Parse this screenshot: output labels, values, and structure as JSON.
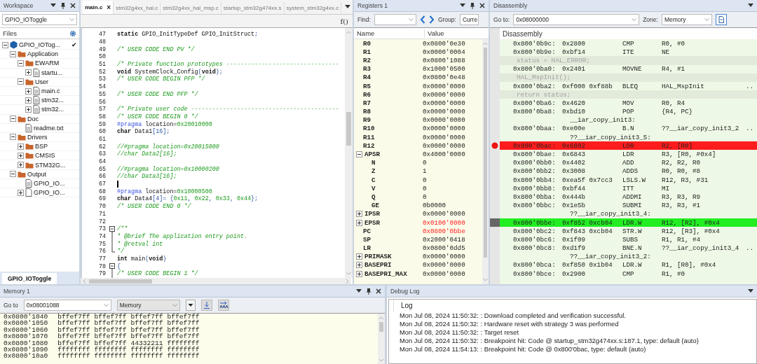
{
  "workspace": {
    "title": "Workspace",
    "project": "GPIO_IOToggle",
    "files_label": "Files",
    "tree": [
      {
        "label": "GPIO_IOTog...",
        "kind": "project",
        "expanded": true,
        "mark": "✔",
        "children": [
          {
            "label": "Application",
            "kind": "folder",
            "expanded": true,
            "children": [
              {
                "label": "EWARM",
                "kind": "folder",
                "expanded": true,
                "children": [
                  {
                    "label": "startu...",
                    "kind": "file",
                    "expanded": false
                  }
                ]
              },
              {
                "label": "User",
                "kind": "folder",
                "expanded": true,
                "children": [
                  {
                    "label": "main.c",
                    "kind": "file",
                    "expanded": false
                  },
                  {
                    "label": "stm32...",
                    "kind": "file",
                    "expanded": false
                  },
                  {
                    "label": "stm32...",
                    "kind": "file",
                    "expanded": false
                  }
                ]
              }
            ]
          },
          {
            "label": "Doc",
            "kind": "folder",
            "expanded": true,
            "children": [
              {
                "label": "readme.txt",
                "kind": "file"
              }
            ]
          },
          {
            "label": "Drivers",
            "kind": "folder",
            "expanded": true,
            "children": [
              {
                "label": "BSP",
                "kind": "folder",
                "expanded": false
              },
              {
                "label": "CMSIS",
                "kind": "folder",
                "expanded": false
              },
              {
                "label": "STM32G...",
                "kind": "folder",
                "expanded": false
              }
            ]
          },
          {
            "label": "Output",
            "kind": "folder",
            "expanded": true,
            "children": [
              {
                "label": "GPIO_IO...",
                "kind": "file"
              },
              {
                "label": "GPIO_IO...",
                "kind": "blank",
                "expanded": false
              }
            ]
          }
        ]
      }
    ],
    "bottom_tabs": [
      {
        "label": "GPIO_IOToggle",
        "selected": true
      }
    ]
  },
  "editor": {
    "tabs": [
      {
        "label": "main.c",
        "selected": true,
        "close": "×"
      },
      {
        "label": "stm32g4xx_hal.c",
        "selected": false
      },
      {
        "label": "stm32g4xx_hal_msp.c",
        "selected": false
      },
      {
        "label": "startup_stm32g474xx.s",
        "selected": false
      },
      {
        "label": "system_stm32g4xx.c",
        "selected": false
      }
    ],
    "function_button": "f()",
    "lines": [
      {
        "number": "47",
        "cursor": false,
        "tokens": [
          {
            "kind": "keyword",
            "text": "static"
          },
          {
            "kind": "plain",
            "text": " GPIO_InitTypeDef  GPIO_InitStruct"
          },
          {
            "kind": "symbol",
            "text": ";"
          }
        ]
      },
      {
        "number": "48",
        "cursor": false
      },
      {
        "number": "49",
        "cursor": false,
        "tokens": [
          {
            "kind": "comment",
            "text": "/* USER CODE END PV */"
          }
        ]
      },
      {
        "number": "50",
        "cursor": false
      },
      {
        "number": "51",
        "cursor": false,
        "tokens": [
          {
            "kind": "comment",
            "text": "/* Private function prototypes --------------------------------"
          }
        ]
      },
      {
        "number": "52",
        "cursor": false,
        "tokens": [
          {
            "kind": "keyword",
            "text": "void"
          },
          {
            "kind": "plain",
            "text": " SystemClock_Config"
          },
          {
            "kind": "symbol",
            "text": "("
          },
          {
            "kind": "keyword",
            "text": "void"
          },
          {
            "kind": "symbol",
            "text": ");"
          }
        ]
      },
      {
        "number": "53",
        "cursor": false,
        "tokens": [
          {
            "kind": "comment",
            "text": "/* USER CODE BEGIN PFP */"
          }
        ]
      },
      {
        "number": "54",
        "cursor": false
      },
      {
        "number": "55",
        "cursor": false,
        "tokens": [
          {
            "kind": "comment",
            "text": "/* USER CODE END PFP */"
          }
        ]
      },
      {
        "number": "56",
        "cursor": false
      },
      {
        "number": "57",
        "cursor": false,
        "tokens": [
          {
            "kind": "comment",
            "text": "/* Private user code ------------------------------------------"
          }
        ]
      },
      {
        "number": "58",
        "cursor": false,
        "tokens": [
          {
            "kind": "comment",
            "text": "/* USER CODE BEGIN 0 */"
          }
        ]
      },
      {
        "number": "59",
        "cursor": false,
        "tokens": [
          {
            "kind": "directive",
            "text": "#pragma"
          },
          {
            "kind": "plain",
            "text": " location="
          },
          {
            "kind": "number",
            "text": "0x20010000"
          }
        ]
      },
      {
        "number": "60",
        "cursor": false,
        "tokens": [
          {
            "kind": "keyword",
            "text": "char"
          },
          {
            "kind": "plain",
            "text": " Data1"
          },
          {
            "kind": "symbol",
            "text": "[16];"
          }
        ]
      },
      {
        "number": "61",
        "cursor": false
      },
      {
        "number": "62",
        "cursor": false,
        "tokens": [
          {
            "kind": "comment",
            "text": "//#pragma location=0x20015000"
          }
        ]
      },
      {
        "number": "63",
        "cursor": false,
        "tokens": [
          {
            "kind": "comment",
            "text": "//char Data2[16];"
          }
        ]
      },
      {
        "number": "64",
        "cursor": false
      },
      {
        "number": "65",
        "cursor": false,
        "tokens": [
          {
            "kind": "comment",
            "text": "//#pragma location=0x10000200"
          }
        ]
      },
      {
        "number": "66",
        "cursor": false,
        "tokens": [
          {
            "kind": "comment",
            "text": "//char Data3[16];"
          }
        ]
      },
      {
        "number": "67",
        "cursor": true
      },
      {
        "number": "68",
        "cursor": false,
        "tokens": [
          {
            "kind": "directive",
            "text": "#pragma"
          },
          {
            "kind": "plain",
            "text": " location="
          },
          {
            "kind": "number",
            "text": "0x10000500"
          }
        ]
      },
      {
        "number": "69",
        "cursor": false,
        "tokens": [
          {
            "kind": "keyword",
            "text": "char"
          },
          {
            "kind": "plain",
            "text": " Data4"
          },
          {
            "kind": "symbol",
            "text": "[4]= {"
          },
          {
            "kind": "number",
            "text": "0x11"
          },
          {
            "kind": "symbol",
            "text": ", "
          },
          {
            "kind": "number",
            "text": "0x22"
          },
          {
            "kind": "symbol",
            "text": ", "
          },
          {
            "kind": "number",
            "text": "0x33"
          },
          {
            "kind": "symbol",
            "text": ", "
          },
          {
            "kind": "number",
            "text": "0x44"
          },
          {
            "kind": "symbol",
            "text": "};"
          }
        ]
      },
      {
        "number": "70",
        "cursor": false,
        "tokens": [
          {
            "kind": "comment",
            "text": "/* USER CODE END 0 */"
          }
        ]
      },
      {
        "number": "71",
        "cursor": false
      },
      {
        "number": "72",
        "cursor": false
      },
      {
        "number": "73",
        "cursor": false,
        "fold": {
          "kind": "open"
        },
        "tokens": [
          {
            "kind": "comment",
            "text": "/**"
          }
        ]
      },
      {
        "number": "74",
        "cursor": false,
        "fold": {
          "kind": "line"
        },
        "tokens": [
          {
            "kind": "comment",
            "text": "  * @brief  The application entry point."
          }
        ]
      },
      {
        "number": "75",
        "cursor": false,
        "fold": {
          "kind": "line"
        },
        "tokens": [
          {
            "kind": "comment",
            "text": "  * @retval int"
          }
        ]
      },
      {
        "number": "76",
        "cursor": false,
        "fold": {
          "kind": "end"
        },
        "tokens": [
          {
            "kind": "comment",
            "text": "  */"
          }
        ]
      },
      {
        "number": "77",
        "cursor": false,
        "tokens": [
          {
            "kind": "keyword",
            "text": "int"
          },
          {
            "kind": "plain",
            "text": " main"
          },
          {
            "kind": "symbol",
            "text": "("
          },
          {
            "kind": "keyword",
            "text": "void"
          },
          {
            "kind": "symbol",
            "text": ")"
          }
        ]
      },
      {
        "number": "78",
        "cursor": false,
        "fold": {
          "kind": "open"
        },
        "tokens": [
          {
            "kind": "symbol",
            "text": "{"
          }
        ]
      },
      {
        "number": "79",
        "cursor": false,
        "fold": {
          "kind": "line"
        },
        "tokens": [
          {
            "kind": "comment",
            "text": "  /* USER CODE BEGIN 1 */"
          }
        ]
      }
    ]
  },
  "registers": {
    "title": "Registers 1",
    "find_label": "Find:",
    "group_label": "Group:",
    "group_value": "Curre",
    "columns": [
      "Name",
      "Value"
    ],
    "rows": [
      {
        "name": "R0",
        "value": "0x0800'0e30",
        "changed": false
      },
      {
        "name": "R1",
        "value": "0x0000'0004",
        "changed": false
      },
      {
        "name": "R2",
        "value": "0x0800'1088",
        "changed": false
      },
      {
        "name": "R3",
        "value": "0x1000'0500",
        "changed": false
      },
      {
        "name": "R4",
        "value": "0x0800'0e48",
        "changed": false
      },
      {
        "name": "R5",
        "value": "0x0000'0000",
        "changed": false
      },
      {
        "name": "R6",
        "value": "0x0000'0000",
        "changed": false
      },
      {
        "name": "R7",
        "value": "0x0000'0000",
        "changed": false
      },
      {
        "name": "R8",
        "value": "0x0000'0000",
        "changed": false
      },
      {
        "name": "R9",
        "value": "0x0000'0000",
        "changed": false
      },
      {
        "name": "R10",
        "value": "0x0000'0000",
        "changed": false
      },
      {
        "name": "R11",
        "value": "0x0000'0000",
        "changed": false
      },
      {
        "name": "R12",
        "value": "0x0000'0000",
        "changed": false
      },
      {
        "name": "APSR",
        "value": "0x4000'0000",
        "changed": false,
        "expanded": true,
        "children": [
          {
            "name": "N",
            "value": "0",
            "changed": false
          },
          {
            "name": "Z",
            "value": "1",
            "changed": false
          },
          {
            "name": "C",
            "value": "0",
            "changed": false
          },
          {
            "name": "V",
            "value": "0",
            "changed": false
          },
          {
            "name": "Q",
            "value": "0",
            "changed": false
          },
          {
            "name": "GE",
            "value": "0b0000",
            "changed": false
          }
        ]
      },
      {
        "name": "IPSR",
        "value": "0x0000'0000",
        "changed": false,
        "expanded": false
      },
      {
        "name": "EPSR",
        "value": "0x0100'0000",
        "changed": true,
        "expanded": false
      },
      {
        "name": "PC",
        "value": "0x0800'0bbe",
        "changed": true
      },
      {
        "name": "SP",
        "value": "0x2000'0418",
        "changed": false
      },
      {
        "name": "LR",
        "value": "0x0800'0dd5",
        "changed": false
      },
      {
        "name": "PRIMASK",
        "value": "0x0000'0000",
        "changed": false,
        "expanded": false
      },
      {
        "name": "BASEPRI",
        "value": "0x0000'0000",
        "changed": false,
        "expanded": false
      },
      {
        "name": "BASEPRI_MAX",
        "value": "0x0000'0000",
        "changed": false,
        "expanded": false
      }
    ]
  },
  "disassembly": {
    "title": "Disassembly",
    "goto_label": "Go to:",
    "goto_value": "0x08000000",
    "zone_label": "Zone:",
    "zone_value": "Memory",
    "header": "Disassembly",
    "rows": [
      {
        "kind": "instr",
        "address": "0x800'0b9c:",
        "code": "0x2800",
        "mnemonic": "CMP",
        "operands": "R0, #0",
        "breakpoint": false,
        "current": false
      },
      {
        "kind": "instr",
        "address": "0x800'0b9e:",
        "code": "0xbf14",
        "mnemonic": "ITE",
        "operands": "NE",
        "breakpoint": false,
        "current": false
      },
      {
        "kind": "source",
        "text": "status = HAL_ERROR;"
      },
      {
        "kind": "instr",
        "address": "0x800'0ba0:",
        "code": "0x2401",
        "mnemonic": "MOVNE",
        "operands": "R4, #1",
        "breakpoint": false,
        "current": false
      },
      {
        "kind": "source",
        "text": "HAL_MspInit();"
      },
      {
        "kind": "instr",
        "address": "0x800'0ba2:",
        "code": "0xf000 0xf88b",
        "mnemonic": "BLEQ",
        "operands": "HAL_MspInit",
        "tail": "..",
        "breakpoint": false,
        "current": false
      },
      {
        "kind": "source",
        "text": "return status;"
      },
      {
        "kind": "instr",
        "address": "0x800'0ba6:",
        "code": "0x4620",
        "mnemonic": "MOV",
        "operands": "R0, R4",
        "breakpoint": false,
        "current": false
      },
      {
        "kind": "instr",
        "address": "0x800'0ba8:",
        "code": "0xbd10",
        "mnemonic": "POP",
        "operands": "{R4, PC}",
        "breakpoint": false,
        "current": false
      },
      {
        "kind": "label",
        "text": "__iar_copy_init3:"
      },
      {
        "kind": "instr",
        "address": "0x800'0baa:",
        "code": "0xe00e",
        "mnemonic": "B.N",
        "operands": "??__iar_copy_init3_2",
        "tail": "..",
        "breakpoint": false,
        "current": false
      },
      {
        "kind": "label",
        "text": "??__iar_copy_init3_5:"
      },
      {
        "kind": "instr",
        "address": "0x800'0bac:",
        "code": "0x6802",
        "mnemonic": "LDR",
        "operands": "R2, [R0]",
        "breakpoint": true,
        "current": false
      },
      {
        "kind": "instr",
        "address": "0x800'0bae:",
        "code": "0x6843",
        "mnemonic": "LDR",
        "operands": "R3, [R0, #0x4]",
        "breakpoint": false,
        "current": false
      },
      {
        "kind": "instr",
        "address": "0x800'0bb0:",
        "code": "0x4402",
        "mnemonic": "ADD",
        "operands": "R2, R2, R0",
        "breakpoint": false,
        "current": false
      },
      {
        "kind": "instr",
        "address": "0x800'0bb2:",
        "code": "0x3008",
        "mnemonic": "ADDS",
        "operands": "R0, R0, #8",
        "breakpoint": false,
        "current": false
      },
      {
        "kind": "instr",
        "address": "0x800'0bb4:",
        "code": "0xea5f 0x7cc3",
        "mnemonic": "LSLS.W",
        "operands": "R12, R3, #31",
        "breakpoint": false,
        "current": false
      },
      {
        "kind": "instr",
        "address": "0x800'0bb8:",
        "code": "0xbf44",
        "mnemonic": "ITT",
        "operands": "MI",
        "breakpoint": false,
        "current": false
      },
      {
        "kind": "instr",
        "address": "0x800'0bba:",
        "code": "0x444b",
        "mnemonic": "ADDMI",
        "operands": "R3, R3, R9",
        "breakpoint": false,
        "current": false
      },
      {
        "kind": "instr",
        "address": "0x800'0bbc:",
        "code": "0x1e5b",
        "mnemonic": "SUBMI",
        "operands": "R3, R3, #1",
        "breakpoint": false,
        "current": false
      },
      {
        "kind": "label",
        "text": "??__iar_copy_init3_4:"
      },
      {
        "kind": "instr",
        "address": "0x800'0bbe:",
        "code": "0xf852 0xcb04",
        "mnemonic": "LDR.W",
        "operands": "R12, [R2], #0x4",
        "breakpoint": false,
        "current": true
      },
      {
        "kind": "instr",
        "address": "0x800'0bc2:",
        "code": "0xf843 0xcb04",
        "mnemonic": "STR.W",
        "operands": "R12, [R3], #0x4",
        "breakpoint": false,
        "current": false
      },
      {
        "kind": "instr",
        "address": "0x800'0bc6:",
        "code": "0x1f09",
        "mnemonic": "SUBS",
        "operands": "R1, R1, #4",
        "breakpoint": false,
        "current": false
      },
      {
        "kind": "instr",
        "address": "0x800'0bc8:",
        "code": "0xd1f9",
        "mnemonic": "BNE.N",
        "operands": "??__iar_copy_init3_4",
        "tail": "..",
        "breakpoint": false,
        "current": false
      },
      {
        "kind": "label",
        "text": "??__iar_copy_init3_2:"
      },
      {
        "kind": "instr",
        "address": "0x800'0bca:",
        "code": "0xf850 0x1b04",
        "mnemonic": "LDR.W",
        "operands": "R1, [R0], #0x4",
        "breakpoint": false,
        "current": false
      },
      {
        "kind": "instr",
        "address": "0x800'0bce:",
        "code": "0x2900",
        "mnemonic": "CMP",
        "operands": "R1, #0",
        "breakpoint": false,
        "current": false
      }
    ]
  },
  "memory": {
    "title": "Memory 1",
    "goto_label": "Go to",
    "goto_value": "0x08001088",
    "zone_value": "Memory",
    "rows": [
      {
        "address": "0x0800'1040",
        "words": [
          "bffef7ff",
          "bffef7ff",
          "bffef7ff",
          "bffef7ff"
        ]
      },
      {
        "address": "0x0800'1050",
        "words": [
          "bffef7ff",
          "bffef7ff",
          "bffef7ff",
          "bffef7ff"
        ]
      },
      {
        "address": "0x0800'1060",
        "words": [
          "bffef7ff",
          "bffef7ff",
          "bffef7ff",
          "bffef7ff"
        ]
      },
      {
        "address": "0x0800'1070",
        "words": [
          "bffef7ff",
          "bffef7ff",
          "bffef7ff",
          "bffef7ff"
        ]
      },
      {
        "address": "0x0800'1080",
        "words": [
          "bffef7ff",
          "bffef7ff",
          "44332211",
          "ffffffff"
        ]
      },
      {
        "address": "0x0800'1090",
        "words": [
          "ffffffff",
          "ffffffff",
          "ffffffff",
          "ffffffff"
        ]
      },
      {
        "address": "0x0800'10a0",
        "words": [
          "ffffffff",
          "ffffffff",
          "ffffffff",
          "ffffffff"
        ]
      }
    ]
  },
  "debug_log": {
    "title": "Debug Log",
    "header": "Log",
    "lines": [
      "Mon Jul 08, 2024 11:50:32: : Download completed and verification successful.",
      "Mon Jul 08, 2024 11:50:32: : Hardware reset with strategy 3 was performed",
      "Mon Jul 08, 2024 11:50:32: : Target reset",
      "Mon Jul 08, 2024 11:50:32: : Breakpoint hit: Code @ startup_stm32g474xx.s:187.1, type: default (auto)",
      "Mon Jul 08, 2024 11:54:13: : Breakpoint hit: Code @ 0x800'0bac, type: default (auto)"
    ]
  }
}
